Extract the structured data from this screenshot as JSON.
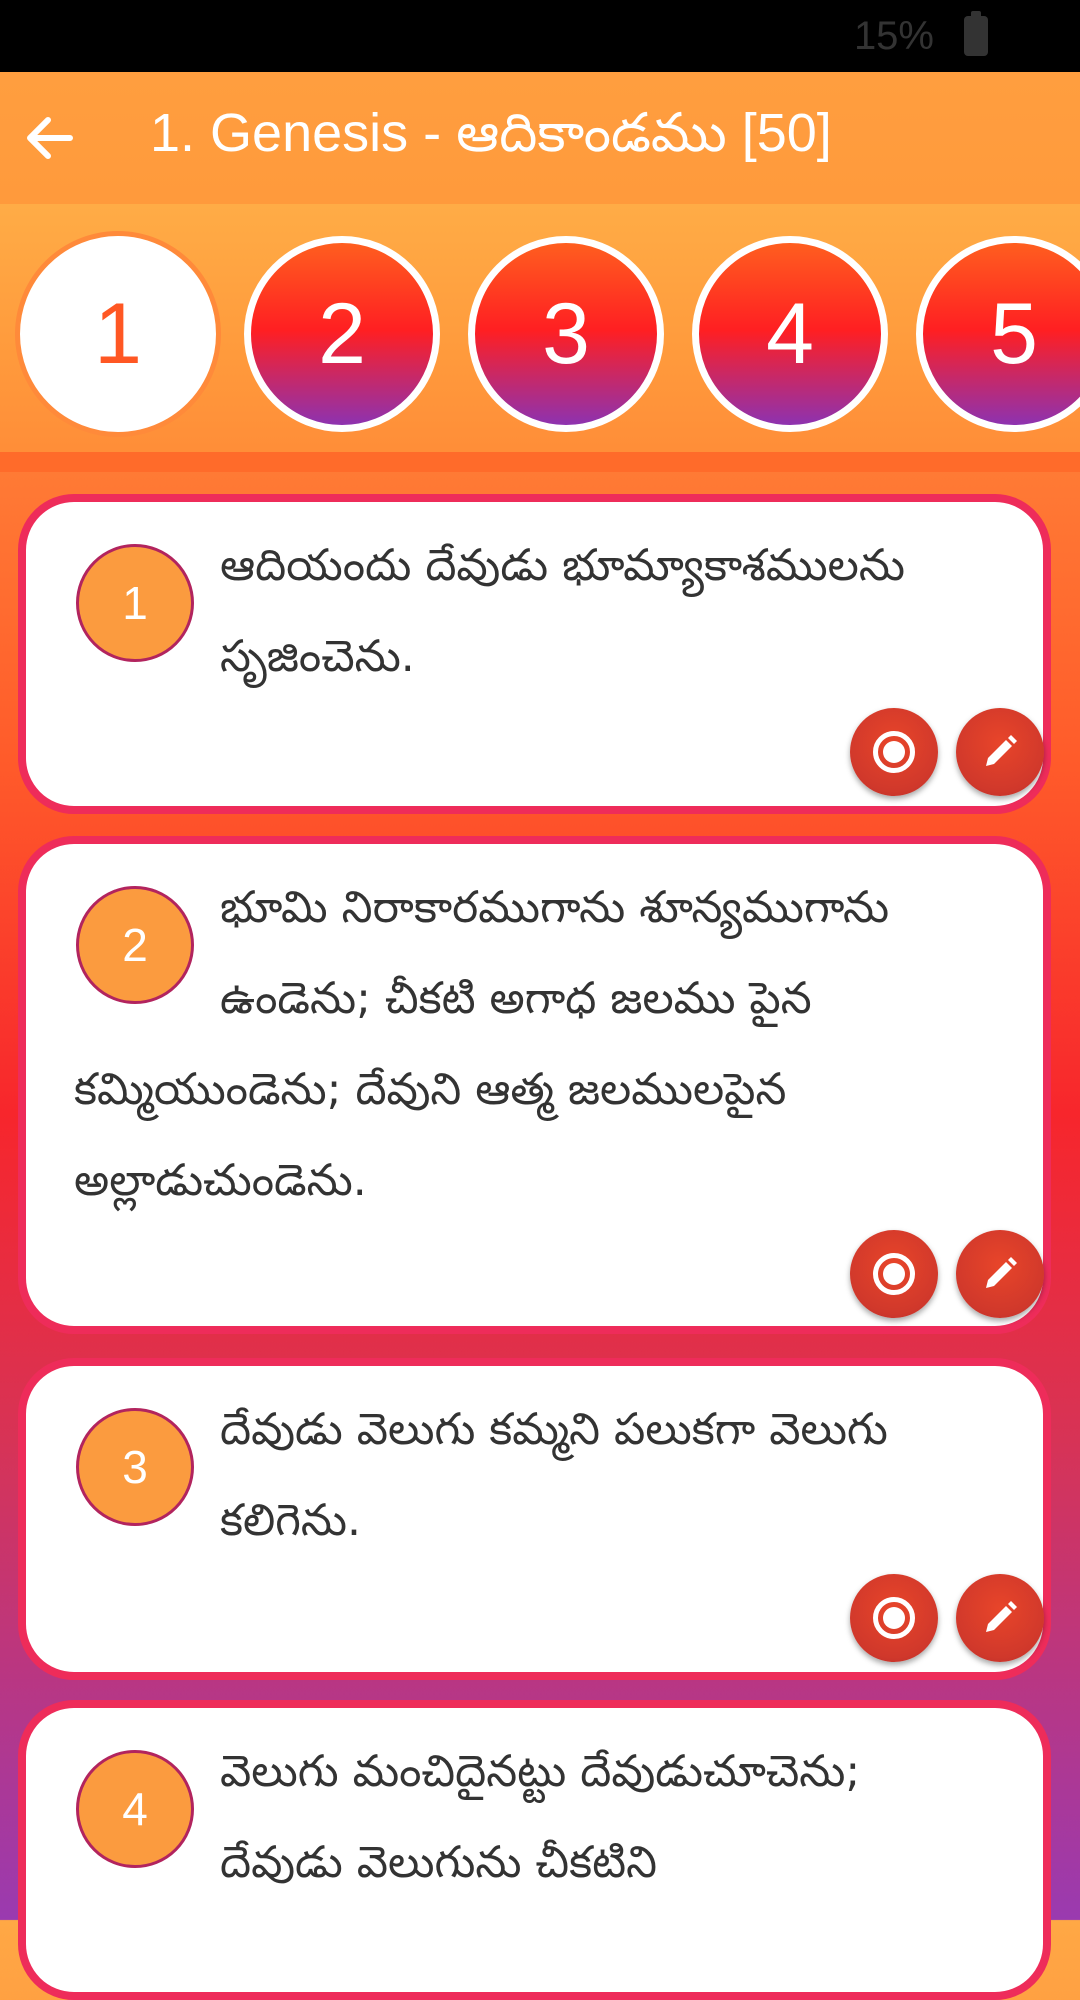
{
  "status_bar": {
    "battery_text": "15%"
  },
  "app_bar": {
    "title": "1. Genesis - ఆదికాండము [50]",
    "back_icon": "arrow-left-icon"
  },
  "chapters": [
    {
      "label": "1",
      "active": true
    },
    {
      "label": "2",
      "active": false
    },
    {
      "label": "3",
      "active": false
    },
    {
      "label": "4",
      "active": false
    },
    {
      "label": "5",
      "active": false
    }
  ],
  "verses": [
    {
      "number": "1",
      "text": "ఆదియందు దేవుడు భూమ్యాకాశములను సృజించెను."
    },
    {
      "number": "2",
      "text": "భూమి నిరాకారముగాను శూన్యముగాను ఉండెను; చీకటి అగాధ జలము పైన కమ్మియుండెను; దేవుని ఆత్మ జలములపైన అల్లాడుచుండెను."
    },
    {
      "number": "3",
      "text": "దేవుడు వెలుగు కమ్మని పలుకగా వెలుగు కలిగెను."
    },
    {
      "number": "4",
      "text": "వెలుగు మంచిదైనట్టు దేవుడుచూచెను; దేవుడు వెలుగును చీకటిని"
    }
  ],
  "icons": {
    "record": "record-icon",
    "edit": "pencil-icon"
  },
  "colors": {
    "accent": "#FF9A3C",
    "card_border": "#EE2C5A",
    "verse_badge": "#FB9B3F",
    "action_button": "#D0382B"
  }
}
